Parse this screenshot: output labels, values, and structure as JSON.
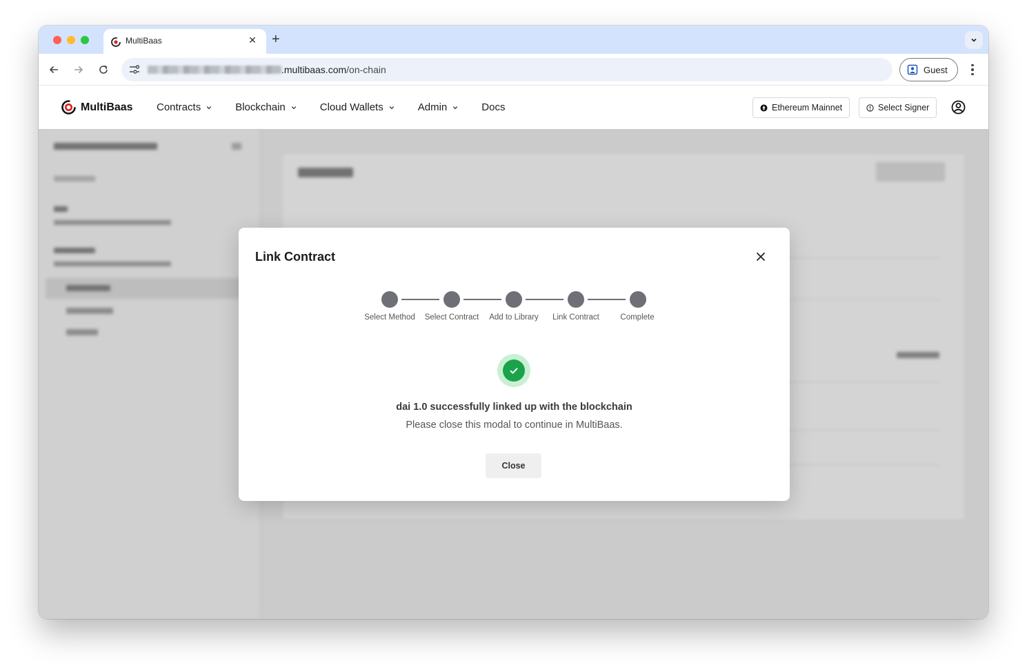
{
  "browser": {
    "tab_title": "MultiBaas",
    "url_host_visible": ".multibaas.com",
    "url_path": "/on-chain",
    "profile_label": "Guest"
  },
  "app": {
    "brand": "MultiBaas",
    "menu": [
      {
        "label": "Contracts",
        "has_dropdown": true
      },
      {
        "label": "Blockchain",
        "has_dropdown": true
      },
      {
        "label": "Cloud Wallets",
        "has_dropdown": true
      },
      {
        "label": "Admin",
        "has_dropdown": true
      },
      {
        "label": "Docs",
        "has_dropdown": false
      }
    ],
    "network_label": "Ethereum Mainnet",
    "signer_label": "Select Signer"
  },
  "modal": {
    "title": "Link Contract",
    "steps": [
      "Select Method",
      "Select Contract",
      "Add to Library",
      "Link Contract",
      "Complete"
    ],
    "success_title": "dai 1.0 successfully linked up with the blockchain",
    "success_subtitle": "Please close this modal to continue in MultiBaas.",
    "close_label": "Close"
  },
  "colors": {
    "brand_red": "#e02020",
    "success_green": "#1aa34a",
    "step_gray": "#6f6f78",
    "tabstrip_blue": "#d3e3fd"
  }
}
